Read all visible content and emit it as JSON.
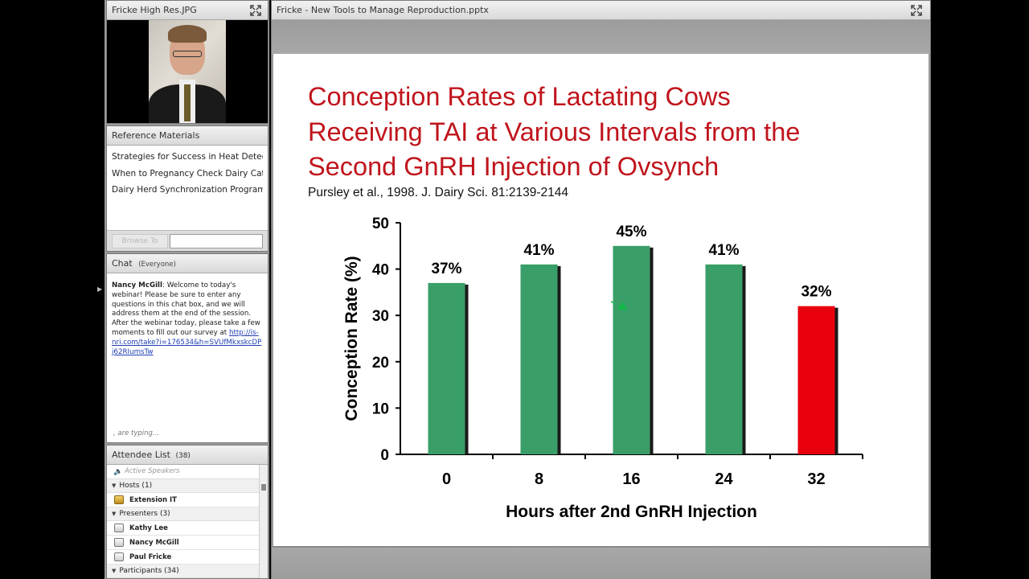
{
  "photo_pod": {
    "title": "Fricke High Res.JPG"
  },
  "reference_pod": {
    "title": "Reference Materials",
    "items": [
      "Strategies for Success in Heat Detection",
      "When to Pregnancy Check Dairy Cattle",
      "Dairy Herd Synchronization Programs"
    ],
    "browse_label": "Browse To",
    "url_value": ""
  },
  "chat_pod": {
    "title": "Chat",
    "subtitle": "(Everyone)",
    "message": {
      "sender": "Nancy McGill",
      "text": ": Welcome to today's webinar! Please be sure to enter any questions in this chat box, and we will address them at the end of the session. After the webinar today, please take a few moments to fill out our survey at ",
      "link": "http://is-nri.com/take?i=176534&h=SVUfMkxskcDPj62RIumsTw"
    },
    "typing_status": ", are typing..."
  },
  "attendee_pod": {
    "title": "Attendee List",
    "count": "(38)",
    "active_speakers": "Active Speakers",
    "groups": {
      "hosts": {
        "label": "Hosts (1)",
        "members": [
          "Extension IT"
        ]
      },
      "presenters": {
        "label": "Presenters (3)",
        "members": [
          "Kathy Lee",
          "Nancy McGill",
          "Paul Fricke"
        ]
      },
      "participants": {
        "label": "Participants (34)"
      }
    }
  },
  "share_pod": {
    "title": "Fricke - New Tools to Manage Reproduction.pptx"
  },
  "slide": {
    "title_lines": [
      "Conception Rates of Lactating Cows",
      "Receiving TAI at Various Intervals from the",
      "Second GnRH Injection of Ovsynch"
    ],
    "citation": "Pursley et al., 1998. J. Dairy Sci. 81:2139-2144"
  },
  "colors": {
    "title_red": "#c0141c",
    "bar_green": "#3a9e68",
    "bar_red": "#e8000d",
    "cursor_green": "#16b84a"
  },
  "chart_data": {
    "type": "bar",
    "categories": [
      "0",
      "8",
      "16",
      "24",
      "32"
    ],
    "values": [
      37,
      41,
      45,
      41,
      32
    ],
    "data_labels": [
      "37%",
      "41%",
      "45%",
      "41%",
      "32%"
    ],
    "bar_colors": [
      "#3a9e68",
      "#3a9e68",
      "#3a9e68",
      "#3a9e68",
      "#e8000d"
    ],
    "xlabel": "Hours after 2nd GnRH Injection",
    "ylabel": "Conception Rate (%)",
    "ylim": [
      0,
      50
    ],
    "yticks": [
      0,
      10,
      20,
      30,
      40,
      50
    ],
    "grid": false
  }
}
